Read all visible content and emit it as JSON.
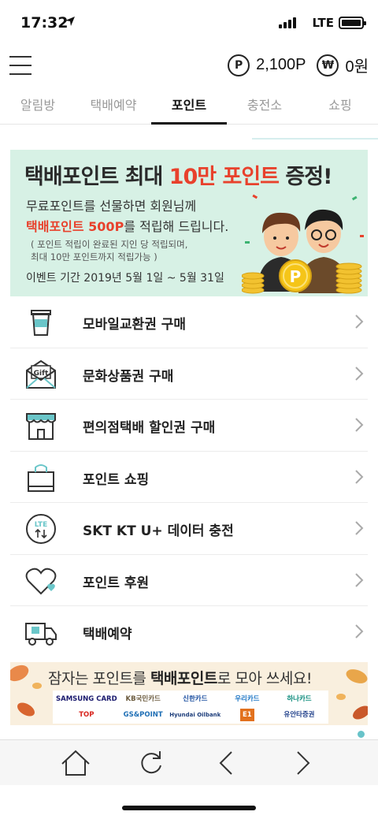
{
  "status_bar": {
    "time": "17:32",
    "network": "LTE"
  },
  "header": {
    "point_icon": "P",
    "points": "2,100P",
    "won_icon": "₩",
    "won": "0원"
  },
  "tabs": [
    {
      "label": "알림방",
      "active": false
    },
    {
      "label": "택배예약",
      "active": false
    },
    {
      "label": "포인트",
      "active": true
    },
    {
      "label": "충전소",
      "active": false
    },
    {
      "label": "쇼핑",
      "active": false
    }
  ],
  "banner": {
    "title_pre": "택배포인트 최대 ",
    "title_hl": "10만 포인트",
    "title_post": " 증정!",
    "line1": "무료포인트를 선물하면 회원님께",
    "line2_hl": "택배포인트 500P",
    "line2_post": "를 적립해 드립니다.",
    "note1": "( 포인트 적립이 완료된 지인 당 적립되며,",
    "note2": "최대 10만 포인트까지 적립가능 )",
    "period": "이벤트 기간 2019년 5월 1일 ~ 5월 31일",
    "coin_letter": "P"
  },
  "menu_items": [
    {
      "label": "모바일교환권 구매",
      "icon": "coffee-cup-icon"
    },
    {
      "label": "문화상품권 구매",
      "icon": "gift-envelope-icon",
      "icon_text": "Gift"
    },
    {
      "label": "편의점택배 할인권 구매",
      "icon": "store-icon"
    },
    {
      "label": "포인트 쇼핑",
      "icon": "shopping-bag-icon"
    },
    {
      "label": "SKT KT U+ 데이터 충전",
      "icon": "lte-data-icon",
      "icon_text": "LTE"
    },
    {
      "label": "포인트 후원",
      "icon": "heart-icon"
    },
    {
      "label": "택배예약",
      "icon": "delivery-truck-icon"
    }
  ],
  "bottom_banner": {
    "pre": "잠자는 포인트를 ",
    "bold": "택배포인트",
    "post": "로 모아 쓰세요!",
    "logos": [
      "SAMSUNG CARD",
      "KB국민카드",
      "신한카드",
      "우리카드",
      "하나카드",
      "TOP",
      "GS&POINT",
      "Hyundai Oilbank",
      "E1",
      "유안타증권"
    ]
  },
  "colors": {
    "accent_red": "#e8412c",
    "banner_bg": "#d7f1e5",
    "teal": "#68c3c9",
    "icon_teal": "#6ac6c9"
  }
}
